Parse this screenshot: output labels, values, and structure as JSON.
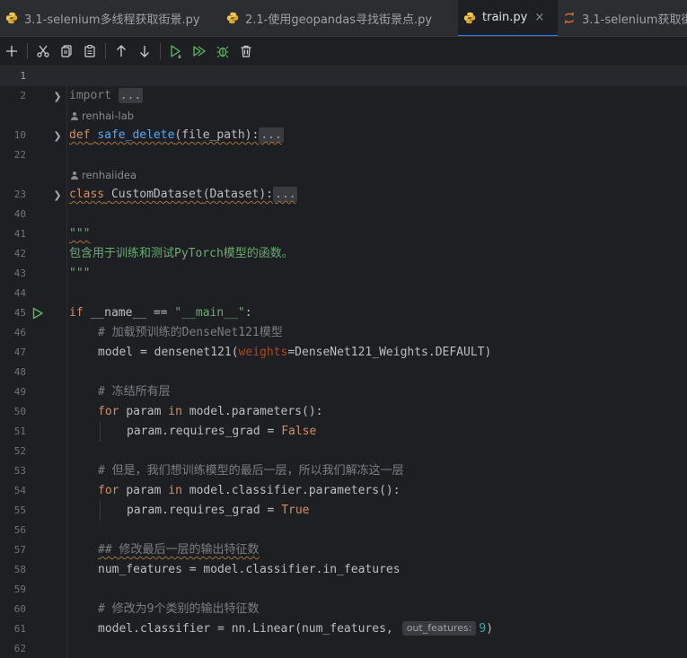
{
  "tabs": [
    {
      "label": "3.1-selenium多线程获取街景.py",
      "icon": "python-icon",
      "active": false
    },
    {
      "label": "2.1-使用geopandas寻找街景点.py",
      "icon": "python-icon",
      "active": false
    },
    {
      "label": "train.py",
      "icon": "python-icon",
      "active": true,
      "close": "×"
    },
    {
      "label": "3.1-selenium获取街",
      "icon": "jupyter-icon",
      "active": false
    }
  ],
  "toolbar": [
    "add-icon",
    "cut-icon",
    "copy-icon",
    "paste-icon",
    "move-up-icon",
    "move-down-icon",
    "run-cell-icon",
    "run-all-icon",
    "debug-icon",
    "delete-icon"
  ],
  "colors": {
    "background": "#1e1f22",
    "keyword": "#cf8e6d",
    "function": "#56a8f5",
    "string": "#6aab73",
    "comment": "#7a7e85",
    "number": "#2aacb8",
    "accent": "#3574f0"
  },
  "editor": {
    "line_numbers": [
      "1",
      "2",
      "10",
      "22",
      "23",
      "40",
      "41",
      "42",
      "43",
      "44",
      "45",
      "46",
      "47",
      "48",
      "49",
      "50",
      "51",
      "52",
      "53",
      "54",
      "55",
      "56",
      "57",
      "58",
      "59",
      "60",
      "61",
      "62"
    ],
    "authors": {
      "a1": "renhai-lab",
      "a2": "renhaiidea"
    },
    "code": {
      "l2_kw": "import",
      "l2_fold": "...",
      "l10_kw": "def",
      "l10_fn": "safe_delete",
      "l10_rest": "(file_path):",
      "l10_fold": "...",
      "l23_kw": "class",
      "l23_name": "CustomDataset",
      "l23_rest": "(Dataset):",
      "l23_fold": "...",
      "l41": "\"\"\"",
      "l42": "包含用于训练和测试PyTorch模型的函数。",
      "l43": "\"\"\"",
      "l45_kw": "if",
      "l45_a": "__name__ ==",
      "l45_str": "\"__main__\"",
      "l45_b": ":",
      "l46": "# 加载预训练的DenseNet121模型",
      "l47_a": "model = densenet121(",
      "l47_param": "weights",
      "l47_b": "=DenseNet121_Weights.DEFAULT)",
      "l49": "# 冻结所有层",
      "l50_kw": "for",
      "l50_a": "param",
      "l50_in": "in",
      "l50_b": "model.parameters():",
      "l51_a": "param.requires_grad =",
      "l51_kw": "False",
      "l53": "# 但是，我们想训练模型的最后一层，所以我们解冻这一层",
      "l54_kw": "for",
      "l54_a": "param",
      "l54_in": "in",
      "l54_b": "model.classifier.parameters():",
      "l55_a": "param.requires_grad =",
      "l55_kw": "True",
      "l57": "## 修改最后一层的输出特征数",
      "l58": "num_features = model.classifier.in_features",
      "l60": "# 修改为9个类别的输出特征数",
      "l61_a": "model.classifier = nn.Linear(num_features,",
      "l61_hint": "out_features:",
      "l61_num": "9",
      "l61_b": ")"
    }
  }
}
